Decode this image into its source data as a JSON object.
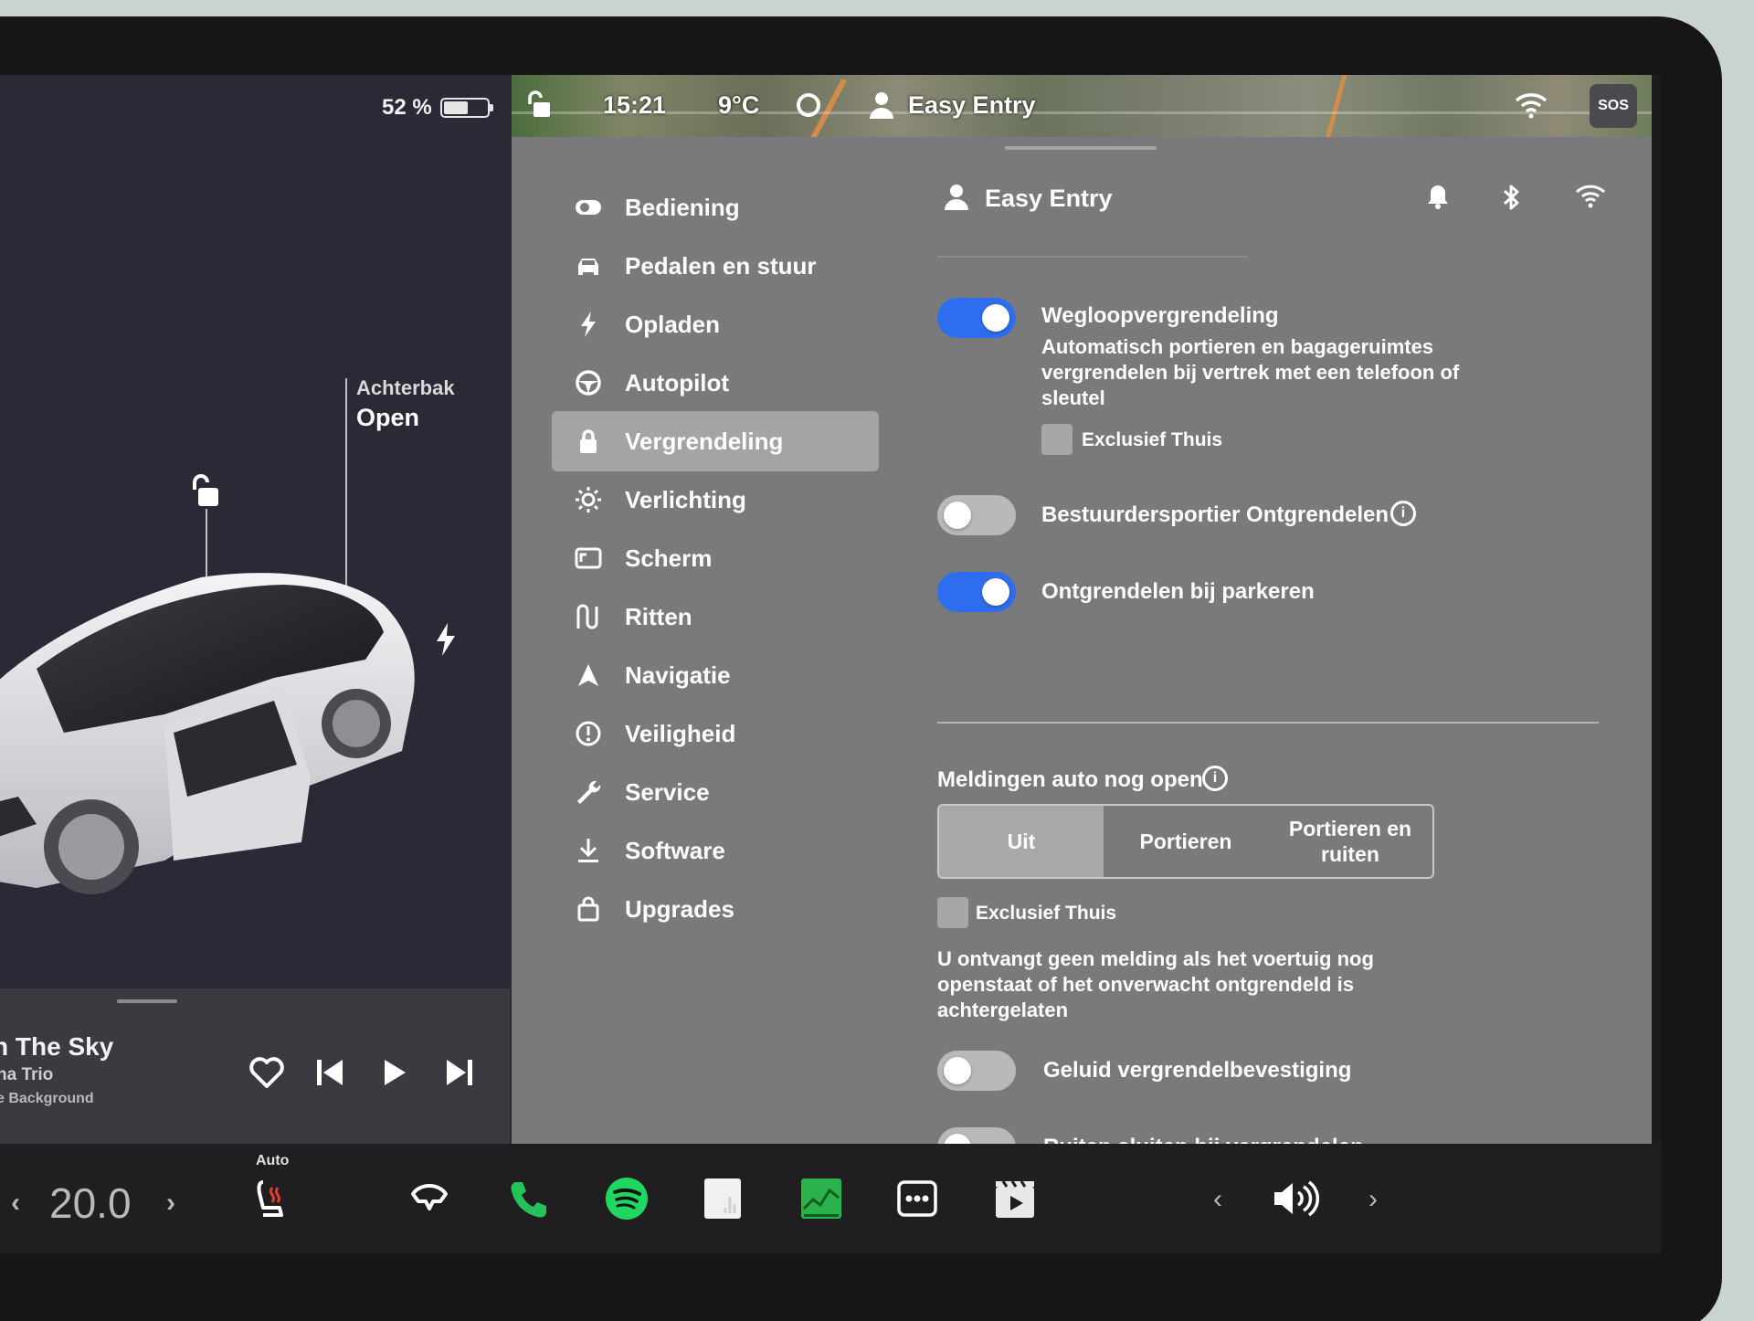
{
  "left_panel": {
    "battery_percent": "52 %",
    "trunk_label": "Achterbak",
    "trunk_status": "Open"
  },
  "media": {
    "title": "n The Sky",
    "artist": "na Trio",
    "source": "e Background"
  },
  "status_bar": {
    "time": "15:21",
    "temperature": "9°C",
    "profile": "Easy Entry",
    "sos_label": "SOS"
  },
  "nav": {
    "items": [
      {
        "label": "Bediening",
        "icon": "toggle-icon"
      },
      {
        "label": "Pedalen en stuur",
        "icon": "car-icon"
      },
      {
        "label": "Opladen",
        "icon": "bolt-icon"
      },
      {
        "label": "Autopilot",
        "icon": "steering-wheel-icon"
      },
      {
        "label": "Vergrendeling",
        "icon": "lock-icon"
      },
      {
        "label": "Verlichting",
        "icon": "sun-icon"
      },
      {
        "label": "Scherm",
        "icon": "display-icon"
      },
      {
        "label": "Ritten",
        "icon": "trips-icon"
      },
      {
        "label": "Navigatie",
        "icon": "navigation-icon"
      },
      {
        "label": "Veiligheid",
        "icon": "safety-icon"
      },
      {
        "label": "Service",
        "icon": "wrench-icon"
      },
      {
        "label": "Software",
        "icon": "download-icon"
      },
      {
        "label": "Upgrades",
        "icon": "shopping-bag-icon"
      }
    ],
    "active_index": 4
  },
  "header": {
    "profile": "Easy Entry"
  },
  "settings": {
    "walk_away_lock": {
      "title": "Wegloopvergrendeling",
      "description": "Automatisch portieren en bagageruimtes vergrendelen bij vertrek met een telefoon of sleutel",
      "enabled": true,
      "exclude_home_label": "Exclusief Thuis",
      "exclude_home_checked": false
    },
    "driver_door_unlock": {
      "title": "Bestuurdersportier Ontgrendelen",
      "enabled": false
    },
    "unlock_on_park": {
      "title": "Ontgrendelen bij parkeren",
      "enabled": true
    },
    "open_alerts": {
      "title": "Meldingen auto nog open",
      "options": [
        "Uit",
        "Portieren",
        "Portieren en ruiten"
      ],
      "selected_index": 0,
      "exclude_home_label": "Exclusief Thuis",
      "exclude_home_checked": false,
      "description": "U ontvangt geen melding als het voertuig nog openstaat of het onverwacht ontgrendeld is achtergelaten"
    },
    "lock_sound": {
      "title": "Geluid vergrendelbevestiging",
      "enabled": false
    },
    "close_windows_on_lock": {
      "title": "Ruiten sluiten bij vergrendelen",
      "enabled": false
    }
  },
  "dock": {
    "cabin_temp": "20.0",
    "seat_heater_mode": "Auto"
  },
  "colors": {
    "accent": "#2f6df0",
    "settings_bg": "#7a7a7d",
    "car_panel_bg": "#2a2a36",
    "spotify_green": "#1ed760",
    "phone_green": "#22c35a"
  }
}
